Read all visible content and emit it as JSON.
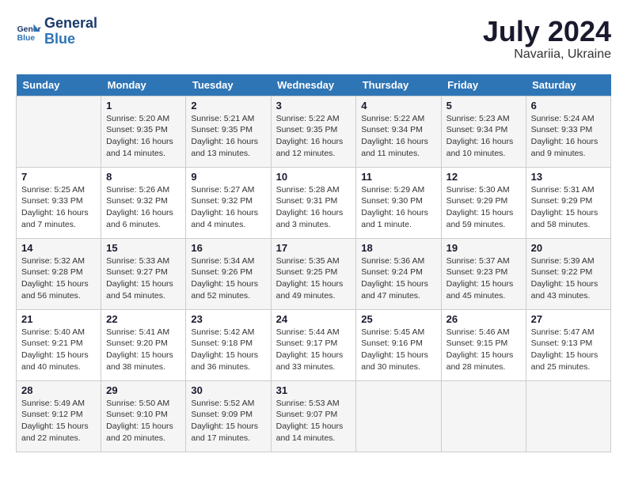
{
  "header": {
    "logo_line1": "General",
    "logo_line2": "Blue",
    "month_year": "July 2024",
    "location": "Navariia, Ukraine"
  },
  "weekdays": [
    "Sunday",
    "Monday",
    "Tuesday",
    "Wednesday",
    "Thursday",
    "Friday",
    "Saturday"
  ],
  "weeks": [
    [
      {
        "day": "",
        "info": ""
      },
      {
        "day": "1",
        "info": "Sunrise: 5:20 AM\nSunset: 9:35 PM\nDaylight: 16 hours\nand 14 minutes."
      },
      {
        "day": "2",
        "info": "Sunrise: 5:21 AM\nSunset: 9:35 PM\nDaylight: 16 hours\nand 13 minutes."
      },
      {
        "day": "3",
        "info": "Sunrise: 5:22 AM\nSunset: 9:35 PM\nDaylight: 16 hours\nand 12 minutes."
      },
      {
        "day": "4",
        "info": "Sunrise: 5:22 AM\nSunset: 9:34 PM\nDaylight: 16 hours\nand 11 minutes."
      },
      {
        "day": "5",
        "info": "Sunrise: 5:23 AM\nSunset: 9:34 PM\nDaylight: 16 hours\nand 10 minutes."
      },
      {
        "day": "6",
        "info": "Sunrise: 5:24 AM\nSunset: 9:33 PM\nDaylight: 16 hours\nand 9 minutes."
      }
    ],
    [
      {
        "day": "7",
        "info": "Sunrise: 5:25 AM\nSunset: 9:33 PM\nDaylight: 16 hours\nand 7 minutes."
      },
      {
        "day": "8",
        "info": "Sunrise: 5:26 AM\nSunset: 9:32 PM\nDaylight: 16 hours\nand 6 minutes."
      },
      {
        "day": "9",
        "info": "Sunrise: 5:27 AM\nSunset: 9:32 PM\nDaylight: 16 hours\nand 4 minutes."
      },
      {
        "day": "10",
        "info": "Sunrise: 5:28 AM\nSunset: 9:31 PM\nDaylight: 16 hours\nand 3 minutes."
      },
      {
        "day": "11",
        "info": "Sunrise: 5:29 AM\nSunset: 9:30 PM\nDaylight: 16 hours\nand 1 minute."
      },
      {
        "day": "12",
        "info": "Sunrise: 5:30 AM\nSunset: 9:29 PM\nDaylight: 15 hours\nand 59 minutes."
      },
      {
        "day": "13",
        "info": "Sunrise: 5:31 AM\nSunset: 9:29 PM\nDaylight: 15 hours\nand 58 minutes."
      }
    ],
    [
      {
        "day": "14",
        "info": "Sunrise: 5:32 AM\nSunset: 9:28 PM\nDaylight: 15 hours\nand 56 minutes."
      },
      {
        "day": "15",
        "info": "Sunrise: 5:33 AM\nSunset: 9:27 PM\nDaylight: 15 hours\nand 54 minutes."
      },
      {
        "day": "16",
        "info": "Sunrise: 5:34 AM\nSunset: 9:26 PM\nDaylight: 15 hours\nand 52 minutes."
      },
      {
        "day": "17",
        "info": "Sunrise: 5:35 AM\nSunset: 9:25 PM\nDaylight: 15 hours\nand 49 minutes."
      },
      {
        "day": "18",
        "info": "Sunrise: 5:36 AM\nSunset: 9:24 PM\nDaylight: 15 hours\nand 47 minutes."
      },
      {
        "day": "19",
        "info": "Sunrise: 5:37 AM\nSunset: 9:23 PM\nDaylight: 15 hours\nand 45 minutes."
      },
      {
        "day": "20",
        "info": "Sunrise: 5:39 AM\nSunset: 9:22 PM\nDaylight: 15 hours\nand 43 minutes."
      }
    ],
    [
      {
        "day": "21",
        "info": "Sunrise: 5:40 AM\nSunset: 9:21 PM\nDaylight: 15 hours\nand 40 minutes."
      },
      {
        "day": "22",
        "info": "Sunrise: 5:41 AM\nSunset: 9:20 PM\nDaylight: 15 hours\nand 38 minutes."
      },
      {
        "day": "23",
        "info": "Sunrise: 5:42 AM\nSunset: 9:18 PM\nDaylight: 15 hours\nand 36 minutes."
      },
      {
        "day": "24",
        "info": "Sunrise: 5:44 AM\nSunset: 9:17 PM\nDaylight: 15 hours\nand 33 minutes."
      },
      {
        "day": "25",
        "info": "Sunrise: 5:45 AM\nSunset: 9:16 PM\nDaylight: 15 hours\nand 30 minutes."
      },
      {
        "day": "26",
        "info": "Sunrise: 5:46 AM\nSunset: 9:15 PM\nDaylight: 15 hours\nand 28 minutes."
      },
      {
        "day": "27",
        "info": "Sunrise: 5:47 AM\nSunset: 9:13 PM\nDaylight: 15 hours\nand 25 minutes."
      }
    ],
    [
      {
        "day": "28",
        "info": "Sunrise: 5:49 AM\nSunset: 9:12 PM\nDaylight: 15 hours\nand 22 minutes."
      },
      {
        "day": "29",
        "info": "Sunrise: 5:50 AM\nSunset: 9:10 PM\nDaylight: 15 hours\nand 20 minutes."
      },
      {
        "day": "30",
        "info": "Sunrise: 5:52 AM\nSunset: 9:09 PM\nDaylight: 15 hours\nand 17 minutes."
      },
      {
        "day": "31",
        "info": "Sunrise: 5:53 AM\nSunset: 9:07 PM\nDaylight: 15 hours\nand 14 minutes."
      },
      {
        "day": "",
        "info": ""
      },
      {
        "day": "",
        "info": ""
      },
      {
        "day": "",
        "info": ""
      }
    ]
  ]
}
